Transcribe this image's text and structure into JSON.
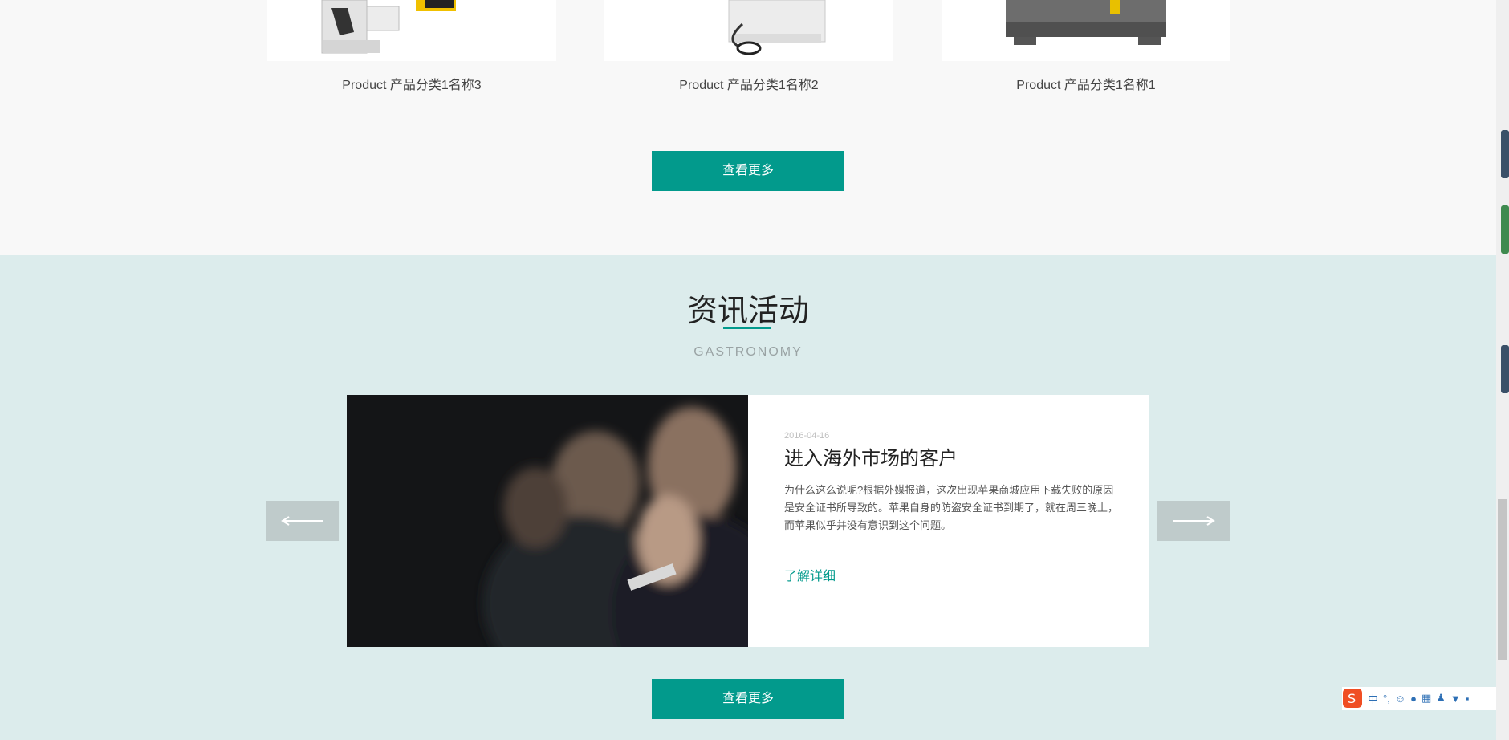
{
  "products": {
    "items": [
      {
        "name": "Product 产品分类1名称3"
      },
      {
        "name": "Product 产品分类1名称2"
      },
      {
        "name": "Product 产品分类1名称1"
      }
    ],
    "more_button": "查看更多"
  },
  "news": {
    "title": "资讯活动",
    "subtitle": "GASTRONOMY",
    "article": {
      "date": "2016-04-16",
      "headline": "进入海外市场的客户",
      "summary": "为什么这么说呢?根据外媒报道，这次出现苹果商城应用下载失败的原因是安全证书所导致的。苹果自身的防盗安全证书到期了，就在周三晚上，而苹果似乎并没有意识到这个问题。",
      "link": "了解详细"
    },
    "more_button": "查看更多"
  },
  "ime": {
    "mode": "中"
  },
  "colors": {
    "accent": "#029a8c",
    "news_background": "#dcecec",
    "arrow_background": "#bfcbcb"
  }
}
